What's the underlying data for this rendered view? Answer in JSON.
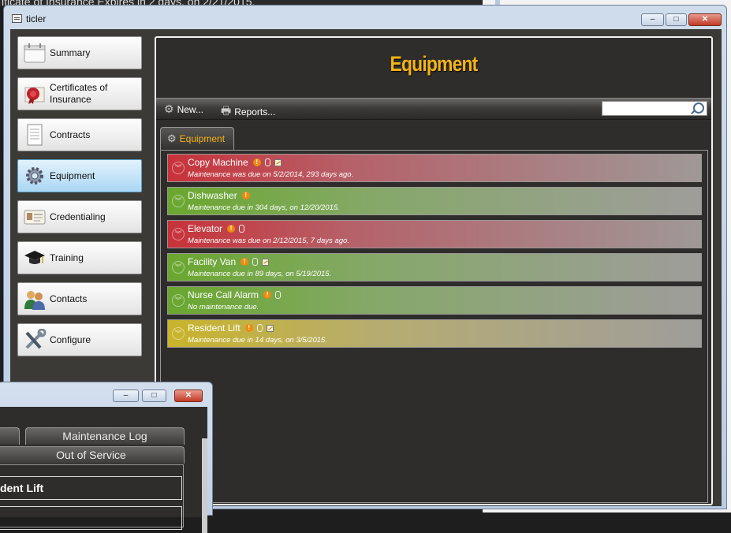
{
  "background": {
    "top_text": "ificate of Insurance Expires in 2 days, on 2/21/2015."
  },
  "window": {
    "title": "ticler",
    "controls": {
      "min": "–",
      "max": "□",
      "close": "✕"
    }
  },
  "sidebar": {
    "items": [
      {
        "label": "Summary",
        "icon": "calendar-icon",
        "active": false
      },
      {
        "label": "Certificates of Insurance",
        "icon": "certificate-seal-icon",
        "active": false
      },
      {
        "label": "Contracts",
        "icon": "document-icon",
        "active": false
      },
      {
        "label": "Equipment",
        "icon": "gear-icon",
        "active": true
      },
      {
        "label": "Credentialing",
        "icon": "id-card-icon",
        "active": false
      },
      {
        "label": "Training",
        "icon": "graduation-cap-icon",
        "active": false
      },
      {
        "label": "Contacts",
        "icon": "people-icon",
        "active": false
      },
      {
        "label": "Configure",
        "icon": "tools-icon",
        "active": false
      }
    ]
  },
  "main": {
    "title": "Equipment",
    "toolbar": {
      "new_label": "New...",
      "reports_label": "Reports...",
      "search_placeholder": ""
    },
    "tab_label": "Equipment",
    "equipment": [
      {
        "name": "Copy Machine",
        "status": "red",
        "detail": "Maintenance was due on 5/2/2014, 293 days ago.",
        "alert": true,
        "attachment": true,
        "note": true
      },
      {
        "name": "Dishwasher",
        "status": "green",
        "detail": "Maintenance due in 304 days, on 12/20/2015.",
        "alert": true,
        "attachment": false,
        "note": false
      },
      {
        "name": "Elevator",
        "status": "red",
        "detail": "Maintenance was due on 2/12/2015, 7 days ago.",
        "alert": true,
        "attachment": true,
        "note": false
      },
      {
        "name": "Facility Van",
        "status": "green",
        "detail": "Maintenance due in 89 days, on 5/19/2015.",
        "alert": true,
        "attachment": true,
        "note": true
      },
      {
        "name": "Nurse Call Alarm",
        "status": "green",
        "detail": "No maintenance due.",
        "alert": true,
        "attachment": true,
        "note": false
      },
      {
        "name": "Resident Lift",
        "status": "yellow",
        "detail": "Maintenance due in 14 days, on 3/5/2015.",
        "alert": true,
        "attachment": true,
        "note": true
      }
    ]
  },
  "child_window": {
    "tabs": [
      "Maintenance Log",
      "Out of Service"
    ],
    "name_value": "dent Lift"
  },
  "colors": {
    "accent": "#f2b416",
    "overdue": "#c8323a",
    "ok": "#6aa72f",
    "warning": "#c9b42a"
  }
}
